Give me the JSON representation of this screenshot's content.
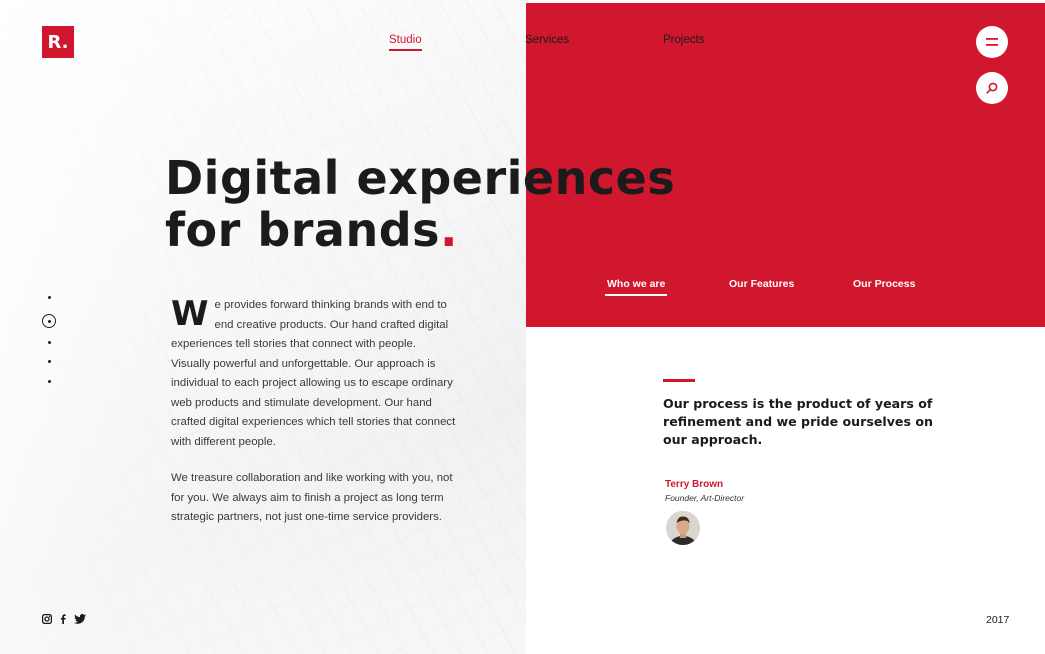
{
  "brand": {
    "logo_text": "R.",
    "accent": "#d0172e"
  },
  "nav": {
    "items": [
      {
        "label": "Studio",
        "active": true
      },
      {
        "label": "Services",
        "active": false
      },
      {
        "label": "Projects",
        "active": false
      }
    ]
  },
  "actions": {
    "menu_icon": "hamburger-icon",
    "search_icon": "search-icon"
  },
  "hero": {
    "headline_line1": "Digital experiences",
    "headline_line2": "for brands",
    "headline_dot": "."
  },
  "slider": {
    "total": 5,
    "active_index": 2
  },
  "about": {
    "dropcap": "W",
    "paragraph1": "e provides forward thinking brands with end to end creative products. Our hand crafted digital experiences tell stories that connect with people. Visually powerful and unforgettable. Our approach is individual to each project allowing us to escape ordinary web products and stimulate development. Our hand crafted digital experiences which tell stories that connect with different people.",
    "paragraph2": "We treasure collaboration and like working with you, not for you. We always aim to finish a project as long term strategic partners, not just one-time service providers."
  },
  "subtabs": [
    {
      "label": "Who we are",
      "active": true
    },
    {
      "label": "Our Features",
      "active": false
    },
    {
      "label": "Our Process",
      "active": false
    }
  ],
  "quote": {
    "text": "Our process is the product of years of refinement and we pride ourselves on our approach.",
    "author_name": "Terry Brown",
    "author_role": "Founder, Art-Director"
  },
  "footer": {
    "social": [
      "instagram-icon",
      "facebook-icon",
      "twitter-icon"
    ],
    "year": "2017"
  }
}
